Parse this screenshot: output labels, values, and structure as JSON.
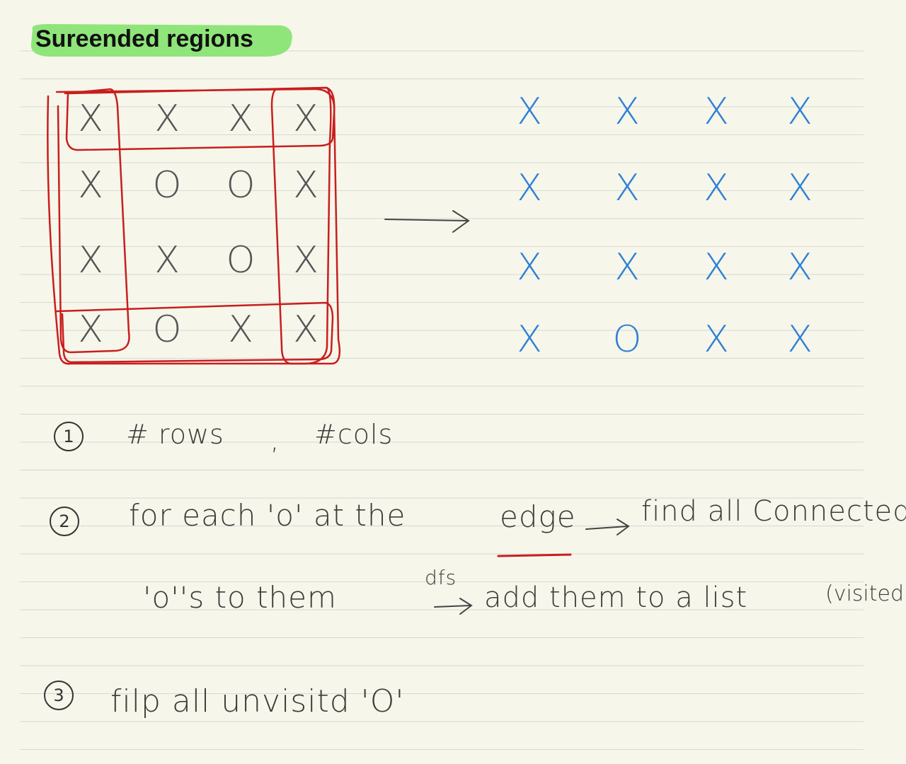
{
  "title": "Sureended regions",
  "colors": {
    "paper": "#f6f6ea",
    "rule": "#d8d8d8",
    "highlight": "#8fe57a",
    "ink": "#3c3c3c",
    "blue": "#2f80d6",
    "red": "#c81e1e"
  },
  "left_grid": [
    [
      "X",
      "X",
      "X",
      "X"
    ],
    [
      "X",
      "O",
      "O",
      "X"
    ],
    [
      "X",
      "X",
      "O",
      "X"
    ],
    [
      "X",
      "O",
      "X",
      "X"
    ]
  ],
  "right_grid": [
    [
      "X",
      "X",
      "X",
      "X"
    ],
    [
      "X",
      "X",
      "X",
      "X"
    ],
    [
      "X",
      "X",
      "X",
      "X"
    ],
    [
      "X",
      "O",
      "X",
      "X"
    ]
  ],
  "steps": {
    "s1_num": "1",
    "s1_a": "# rows",
    "s1_b": ",",
    "s1_c": "#cols",
    "s2_num": "2",
    "s2_a": "for each 'o' at the",
    "s2_edge": "edge",
    "s2_b": "find all Connected",
    "s2_c": "'o''s to them",
    "s2_dfs": "dfs",
    "s2_d": "add them to a list",
    "s2_e": "(visited)",
    "s3_num": "3",
    "s3_a": "filp all unvisitd 'O'"
  }
}
